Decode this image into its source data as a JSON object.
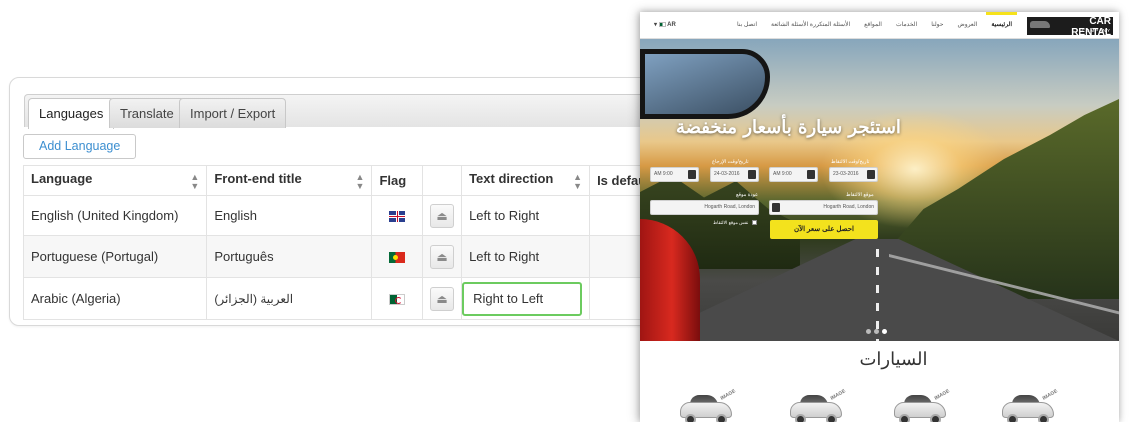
{
  "admin": {
    "tabs": [
      {
        "label": "Languages",
        "active": true
      },
      {
        "label": "Translate",
        "active": false
      },
      {
        "label": "Import / Export",
        "active": false
      }
    ],
    "add_button": "Add Language",
    "columns": [
      "Language",
      "Front-end title",
      "Flag",
      "",
      "Text direction",
      "Is default"
    ],
    "rows": [
      {
        "language": "English (United Kingdom)",
        "title": "English",
        "flag": "uk-flag",
        "direction": "Left to Right",
        "is_default": true
      },
      {
        "language": "Portuguese (Portugal)",
        "title": "Português",
        "flag": "portugal-flag",
        "direction": "Left to Right",
        "is_default": false
      },
      {
        "language": "Arabic (Algeria)",
        "title": "العربية (الجزائر)",
        "flag": "algeria-flag",
        "direction": "Right to Left",
        "is_default": false
      }
    ],
    "colors": {
      "accent_link": "#3d8fd0",
      "check_on": "#41b843",
      "focus_border": "#6ccb5f"
    }
  },
  "site": {
    "logo": {
      "title": "CAR RENTAL",
      "subtitle": "COMPANY"
    },
    "nav": [
      "الرئيسية",
      "العروض",
      "حولنا",
      "الخدمات",
      "المواقع",
      "الأسئلة المتكررة الأسئلة الشائعة",
      "اتصل بنا"
    ],
    "lang_selector": "AR",
    "hero_title": "استئجر سيارة بأسعار منخفضة",
    "form": {
      "pickup_date_label": "تاريخ/وقت الالتقاط",
      "return_date_label": "تاريخ/وقت الإرجاع",
      "pickup_date": "23-03-2016",
      "pickup_time": "AM 9:00",
      "return_date": "24-03-2016",
      "return_time": "AM 9:00",
      "pickup_location_label": "موقع الالتقاط",
      "return_location_label": "عودة موقع",
      "pickup_location": "Hogarth Road, London",
      "return_location": "Hogarth Road, London",
      "note": "لا يمكنك إيجاد الموقع؟ عرض الخريطة",
      "same_location": "نفس موقع الالتقاط",
      "cta": "احصل على سعر الآن"
    },
    "cars_title": "السيارات",
    "car_badge": "IMAGE",
    "colors": {
      "accent_yellow": "#f3e21d"
    }
  }
}
